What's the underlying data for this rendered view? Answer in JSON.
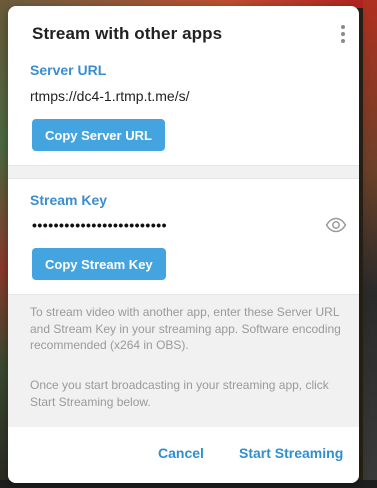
{
  "dialog": {
    "title": "Stream with other apps",
    "menu_icon": "more-vertical-icon"
  },
  "server": {
    "label": "Server URL",
    "url": "rtmps://dc4-1.rtmp.t.me/s/",
    "copy_button": "Copy Server URL"
  },
  "key": {
    "label": "Stream Key",
    "masked_value": "•••••••••••••••••••••••••",
    "reveal_icon": "eye-icon",
    "copy_button": "Copy Stream Key"
  },
  "info": {
    "paragraph_1": "To stream video with another app, enter these Server URL and Stream Key in your streaming app. Software encoding recommended (x264 in OBS).",
    "paragraph_2": "Once you start broadcasting in your streaming app, click Start Streaming below."
  },
  "footer": {
    "cancel": "Cancel",
    "start": "Start Streaming"
  },
  "colors": {
    "accent": "#3a8ed0",
    "button_bg": "#44a4e0",
    "info_bg": "#f1f1f1",
    "info_text": "#9a9a9a"
  }
}
